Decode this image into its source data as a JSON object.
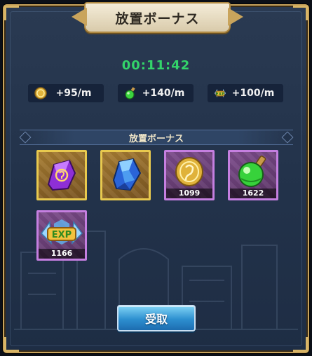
{
  "panel": {
    "title": "放置ボーナス",
    "timer": "00:11:42"
  },
  "rates": [
    {
      "icon": "gold-coin-icon",
      "value": "+95/m"
    },
    {
      "icon": "green-potion-icon",
      "value": "+140/m"
    },
    {
      "icon": "exp-badge-icon",
      "value": "+100/m"
    }
  ],
  "rewards": {
    "header": "放置ボーナス",
    "items": [
      {
        "icon": "purple-rune-stone-icon",
        "rarity": "gold",
        "count": ""
      },
      {
        "icon": "blue-crystal-icon",
        "rarity": "gold",
        "count": ""
      },
      {
        "icon": "gold-coin-icon",
        "rarity": "purple",
        "count": "1099"
      },
      {
        "icon": "green-potion-icon",
        "rarity": "purple",
        "count": "1622"
      },
      {
        "icon": "exp-badge-icon",
        "rarity": "purple",
        "count": "1166"
      }
    ]
  },
  "claim_button": {
    "label": "受取"
  },
  "colors": {
    "timer": "#33d46a",
    "frame_gold": "#c9a45c",
    "tile_gold_border": "#e8c94e",
    "tile_purple_border": "#c57fe0",
    "claim_button": "#2d8fd0"
  }
}
